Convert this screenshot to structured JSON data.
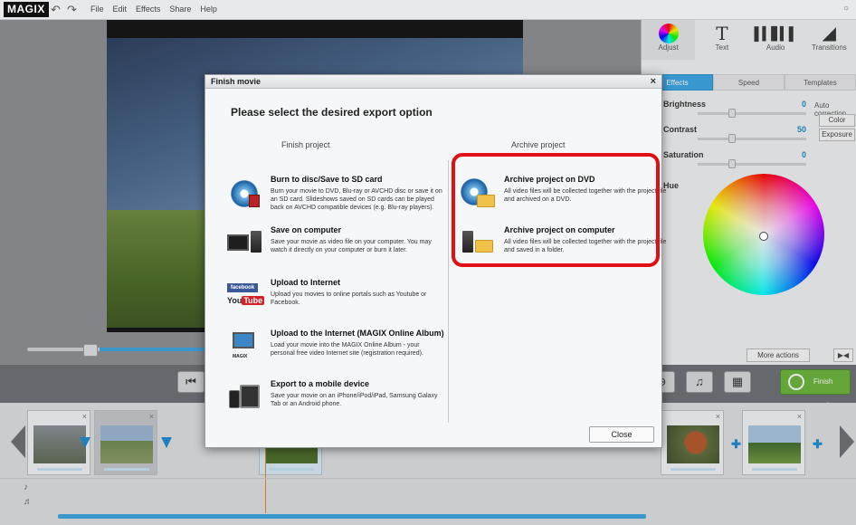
{
  "app": {
    "logo": "MAGIX",
    "menu": [
      "File",
      "Edit",
      "Effects",
      "Share",
      "Help"
    ]
  },
  "right_panel": {
    "tabs": [
      {
        "label": "Adjust",
        "icon": "color-circle-icon"
      },
      {
        "label": "Text",
        "icon": "text-icon"
      },
      {
        "label": "Audio",
        "icon": "audio-wave-icon"
      },
      {
        "label": "Transitions",
        "icon": "transition-icon"
      }
    ],
    "subtabs": [
      "Effects",
      "Speed",
      "Templates"
    ],
    "properties": [
      {
        "label": "Brightness",
        "value": "0"
      },
      {
        "label": "Contrast",
        "value": "50"
      },
      {
        "label": "Saturation",
        "value": "0"
      }
    ],
    "hue_label": "Hue",
    "auto_correction_label": "Auto correction",
    "color_button": "Color",
    "exposure_button": "Exposure",
    "more_actions": "More actions"
  },
  "toolbar": {
    "finish_movie": "Finish movie"
  },
  "dialog": {
    "title": "Finish movie",
    "heading": "Please select the desired export option",
    "left_column_title": "Finish project",
    "right_column_title": "Archive project",
    "left_options": [
      {
        "title": "Burn to disc/Save to SD card",
        "desc": "Burn your movie to DVD, Blu-ray or AVCHD disc or save it on an SD card. Slideshows saved on SD cards can be played back on AVCHD compatible devices (e.g. Blu-ray players)."
      },
      {
        "title": "Save on computer",
        "desc": "Save your movie as video file on your computer. You may watch it directly on your computer or burn it later."
      },
      {
        "title": "Upload to Internet",
        "desc": "Upload you movies to online portals such as Youtube or Facebook."
      },
      {
        "title": "Upload to the Internet (MAGIX Online Album)",
        "desc": "Load your movie into the MAGIX Online Album - your personal free video Internet site (registration required)."
      },
      {
        "title": "Export to a mobile device",
        "desc": "Save your movie on an iPhone/iPod/iPad, Samsung Galaxy Tab or an Android phone."
      }
    ],
    "right_options": [
      {
        "title": "Archive project on DVD",
        "desc": "All video files will be collected together with the project file and archived on a DVD."
      },
      {
        "title": "Archive project on computer",
        "desc": "All video files will be collected together with the project file and saved in a folder."
      }
    ],
    "close_button": "Close",
    "facebook_label": "facebook",
    "youtube_label": "You",
    "youtube_tube": "Tube",
    "magix_small": "MAGIX"
  },
  "colors": {
    "accent": "#3aa6e5",
    "highlight": "#e10e14",
    "finish_green": "#6ab63a"
  }
}
